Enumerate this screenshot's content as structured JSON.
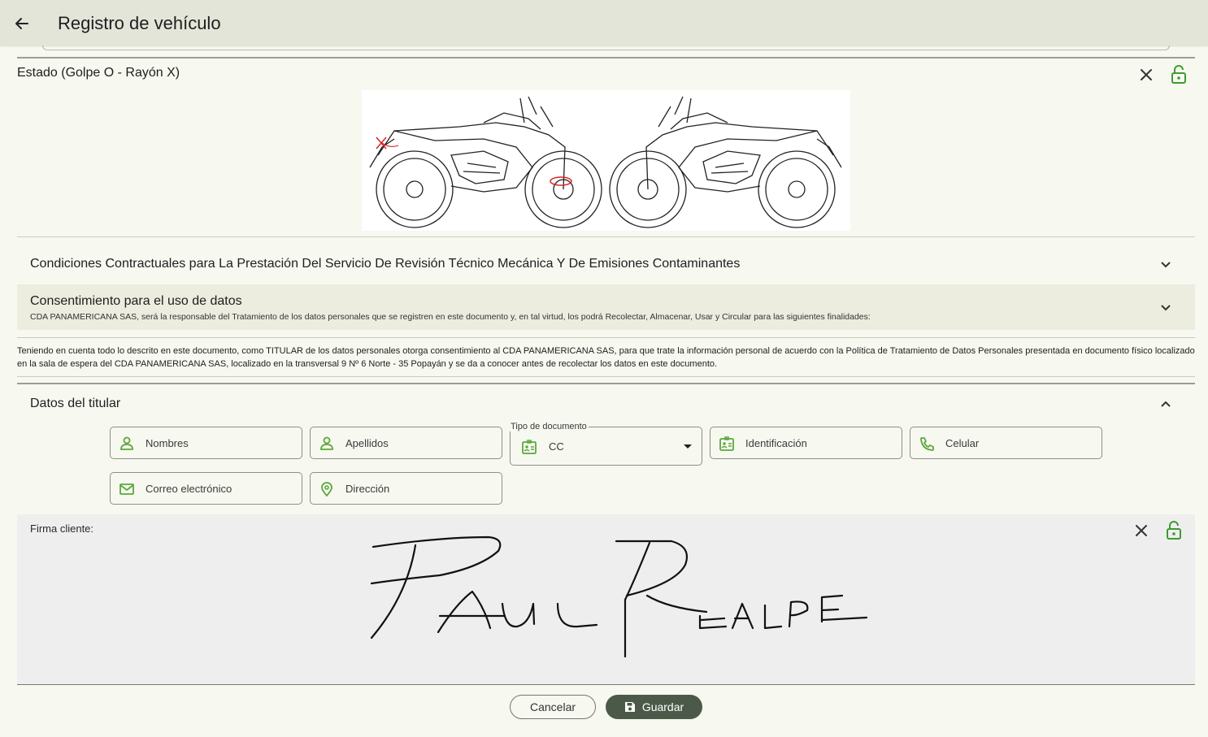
{
  "header": {
    "title": "Registro de vehículo",
    "back_icon": "arrow-left-icon"
  },
  "estado": {
    "title": "Estado (Golpe O - Rayón X)",
    "lock_color": "#3f9b2f"
  },
  "accordions": {
    "condiciones": {
      "title": "Condiciones Contractuales para La Prestación Del Servicio De Revisión Técnico Mecánica Y De Emisiones Contaminantes"
    },
    "consentimiento": {
      "title": "Consentimiento para el uso de datos",
      "subtitle": "CDA PANAMERICANA SAS,  será la responsable del Tratamiento de los datos personales que se registren en este documento y, en tal virtud, los podrá Recolectar, Almacenar, Usar y Circular para las siguientes finalidades:"
    },
    "titular": {
      "title": "Datos del titular"
    }
  },
  "consent_text": "Teniendo en cuenta todo lo descrito en este documento, como TITULAR de los datos personales otorga consentimiento al CDA PANAMERICANA SAS, para que trate la información personal de acuerdo con la Política de Tratamiento de Datos Personales presentada en documento físico localizado en la sala de espera del CDA PANAMERICANA SAS, localizado en la transversal 9 Nº 6 Norte - 35 Popayán y se da a conocer antes de recolectar los datos en este documento.",
  "form": {
    "nombres": {
      "placeholder": "Nombres",
      "icon": "person-icon"
    },
    "apellidos": {
      "placeholder": "Apellidos",
      "icon": "person-icon"
    },
    "tipo_documento": {
      "label": "Tipo de documento",
      "value": "CC",
      "icon": "id-card-icon"
    },
    "identificacion": {
      "placeholder": "Identificación",
      "icon": "id-card-icon"
    },
    "celular": {
      "placeholder": "Celular",
      "icon": "phone-icon"
    },
    "correo": {
      "placeholder": "Correo electrónico",
      "icon": "mail-icon"
    },
    "direccion": {
      "placeholder": "Dirección",
      "icon": "location-pin-icon"
    },
    "icon_color": "#5aa83c"
  },
  "signature": {
    "label": "Firma cliente:"
  },
  "actions": {
    "cancel": "Cancelar",
    "save": "Guardar",
    "save_bg": "#4b5a48"
  }
}
